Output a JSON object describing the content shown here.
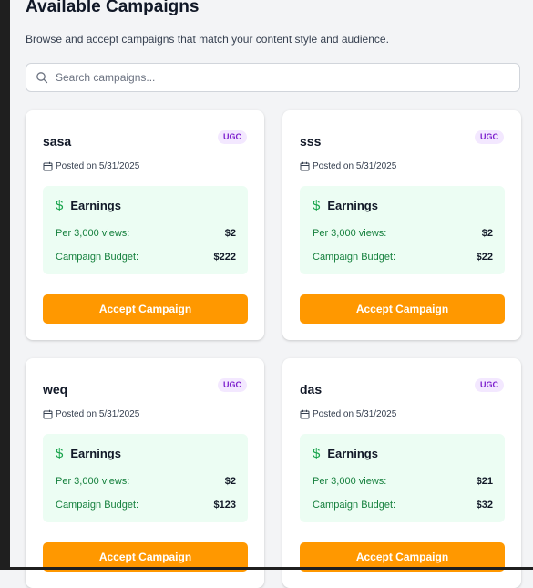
{
  "header": {
    "title": "Available Campaigns",
    "subtitle": "Browse and accept campaigns that match your content style and audience."
  },
  "search": {
    "placeholder": "Search campaigns...",
    "icon": "search-icon"
  },
  "colors": {
    "accent_button": "#ff9800",
    "earnings_panel": "#ecfdf3",
    "earnings_dollar": "#16a34a",
    "badge_bg": "#f3e8ff",
    "badge_text": "#7e22ce"
  },
  "campaigns": [
    {
      "name": "sasa",
      "type": "UGC",
      "posted": "Posted on 5/31/2025",
      "earnings_title": "Earnings",
      "views_label": "Per 3,000 views:",
      "views_value": "$2",
      "budget_label": "Campaign Budget:",
      "budget_value": "$222",
      "button": "Accept Campaign"
    },
    {
      "name": "sss",
      "type": "UGC",
      "posted": "Posted on 5/31/2025",
      "earnings_title": "Earnings",
      "views_label": "Per 3,000 views:",
      "views_value": "$2",
      "budget_label": "Campaign Budget:",
      "budget_value": "$22",
      "button": "Accept Campaign"
    },
    {
      "name": "weq",
      "type": "UGC",
      "posted": "Posted on 5/31/2025",
      "earnings_title": "Earnings",
      "views_label": "Per 3,000 views:",
      "views_value": "$2",
      "budget_label": "Campaign Budget:",
      "budget_value": "$123",
      "button": "Accept Campaign"
    },
    {
      "name": "das",
      "type": "UGC",
      "posted": "Posted on 5/31/2025",
      "earnings_title": "Earnings",
      "views_label": "Per 3,000 views:",
      "views_value": "$21",
      "budget_label": "Campaign Budget:",
      "budget_value": "$32",
      "button": "Accept Campaign"
    }
  ]
}
